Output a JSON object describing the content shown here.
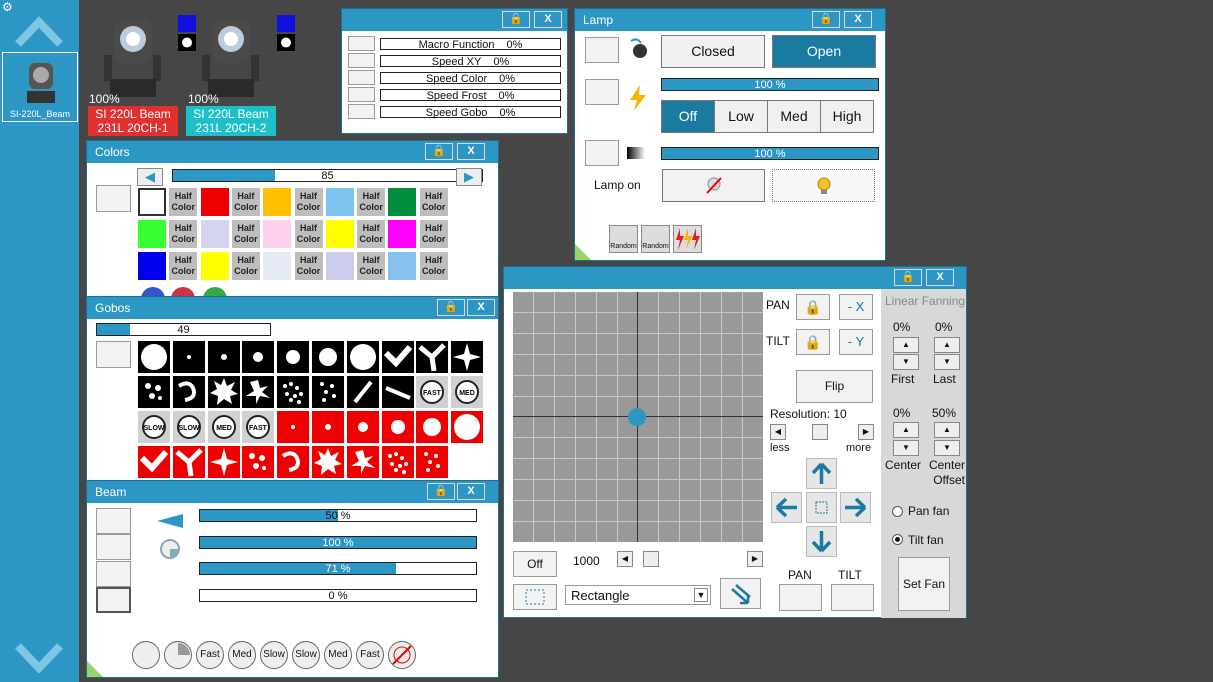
{
  "sidebar": {
    "fixture_caption": "SI-220L_Beam"
  },
  "fixtures": [
    {
      "pct": "100%",
      "line1": "SI 220L Beam",
      "line2": "231L 20CH-1",
      "color": "#e03030"
    },
    {
      "pct": "100%",
      "line1": "SI 220L Beam",
      "line2": "231L 20CH-2",
      "color": "#1ec0c8"
    }
  ],
  "macro": {
    "items": [
      {
        "label": "Macro Function",
        "value": "0%"
      },
      {
        "label": "Speed XY",
        "value": "0%"
      },
      {
        "label": "Speed Color",
        "value": "0%"
      },
      {
        "label": "Speed Frost",
        "value": "0%"
      },
      {
        "label": "Speed Gobo",
        "value": "0%"
      }
    ]
  },
  "lamp": {
    "title": "Lamp",
    "closed": "Closed",
    "open": "Open",
    "bar1": "100 %",
    "bar2": "100 %",
    "bar1_value": 1.0,
    "bar2_value": 1.0,
    "off": "Off",
    "low": "Low",
    "med": "Med",
    "high": "High",
    "lamp_on": "Lamp on",
    "random1": "Random",
    "random2": "Random"
  },
  "colors": {
    "title": "Colors",
    "value": "85",
    "value_fraction": 0.33,
    "half_label": "Half Color",
    "row1": [
      "#ffffff",
      "half",
      "#ee0000",
      "half",
      "#ffc000",
      "half",
      "#7fc4ee",
      "half",
      "#008c3c",
      "half"
    ],
    "row2": [
      "#33ff33",
      "half",
      "#d4d4f0",
      "half",
      "#ffd0ee",
      "half",
      "#ffff00",
      "half",
      "#ff00ff",
      "half"
    ],
    "row3": [
      "#0000ee",
      "half",
      "#ffff00",
      "half",
      "#e6eaf4",
      "half",
      "#ccccee",
      "half",
      "#88c0ee",
      "half"
    ]
  },
  "gobos": {
    "title": "Gobos",
    "value": "49",
    "value_fraction": 0.19,
    "fast": "FAST",
    "med": "MED",
    "slow": "SLOW"
  },
  "beam": {
    "title": "Beam",
    "bars": [
      {
        "text": "50 %",
        "fraction": 0.5
      },
      {
        "text": "100 %",
        "fraction": 1.0
      },
      {
        "text": "71 %",
        "fraction": 0.71
      },
      {
        "text": "0 %",
        "fraction": 0.0
      }
    ],
    "pills": [
      "",
      "",
      "Fast",
      "Med",
      "Slow",
      "Slow",
      "Med",
      "Fast",
      ""
    ]
  },
  "position": {
    "pan": "PAN",
    "tilt": "TILT",
    "neg_x": "- X",
    "neg_y": "- Y",
    "flip": "Flip",
    "resolution": "Resolution: 10",
    "less": "less",
    "more": "more",
    "off": "Off",
    "speed": "1000",
    "shape": "Rectangle",
    "pan_label": "PAN",
    "tilt_label": "TILT",
    "fanning_title": "Linear Fanning",
    "first_pct": "0%",
    "last_pct": "0%",
    "first": "First",
    "last": "Last",
    "center_pct": "0%",
    "offset_pct": "50%",
    "center": "Center",
    "center_offset": "Center Offset",
    "pan_fan": "Pan fan",
    "tilt_fan": "Tilt fan",
    "set_fan": "Set Fan"
  }
}
